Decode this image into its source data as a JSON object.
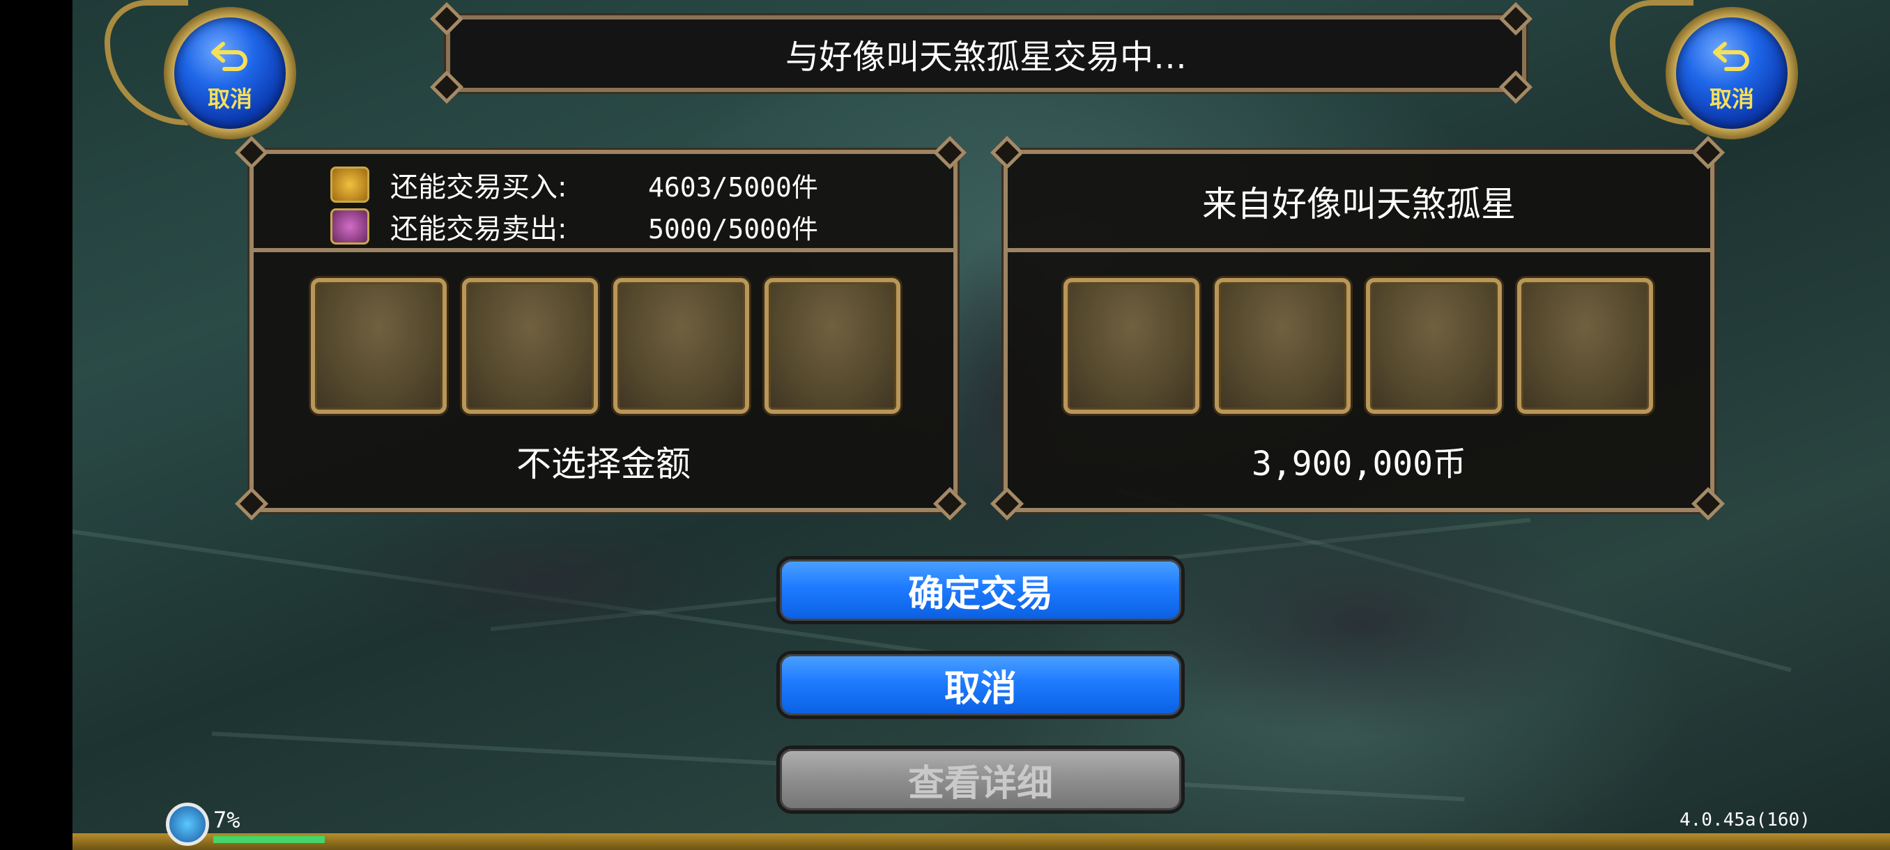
{
  "title": "与好像叫天煞孤星交易中…",
  "corner_cancel": {
    "label": "取消",
    "icon": "return-arrow-icon"
  },
  "my_panel": {
    "buy_label": "还能交易买入:",
    "buy_value": "4603/5000件",
    "sell_label": "还能交易卖出:",
    "sell_value": "5000/5000件",
    "buy_icon": "treasure-chest-icon",
    "sell_icon": "merchant-card-icon",
    "amount": "不选择金额"
  },
  "partner_panel": {
    "title": "来自好像叫天煞孤星",
    "amount": "3,900,000币"
  },
  "buttons": {
    "confirm": "确定交易",
    "cancel": "取消",
    "details": "查看详细"
  },
  "hud": {
    "progress_percent": "7%",
    "progress_fraction": 0.07,
    "version": "4.0.45a(160)"
  },
  "colors": {
    "button_blue": "#1e7bff",
    "button_gray": "#8e8e8e",
    "frame_gold": "#9c8464",
    "cancel_label": "#f5e05a"
  }
}
